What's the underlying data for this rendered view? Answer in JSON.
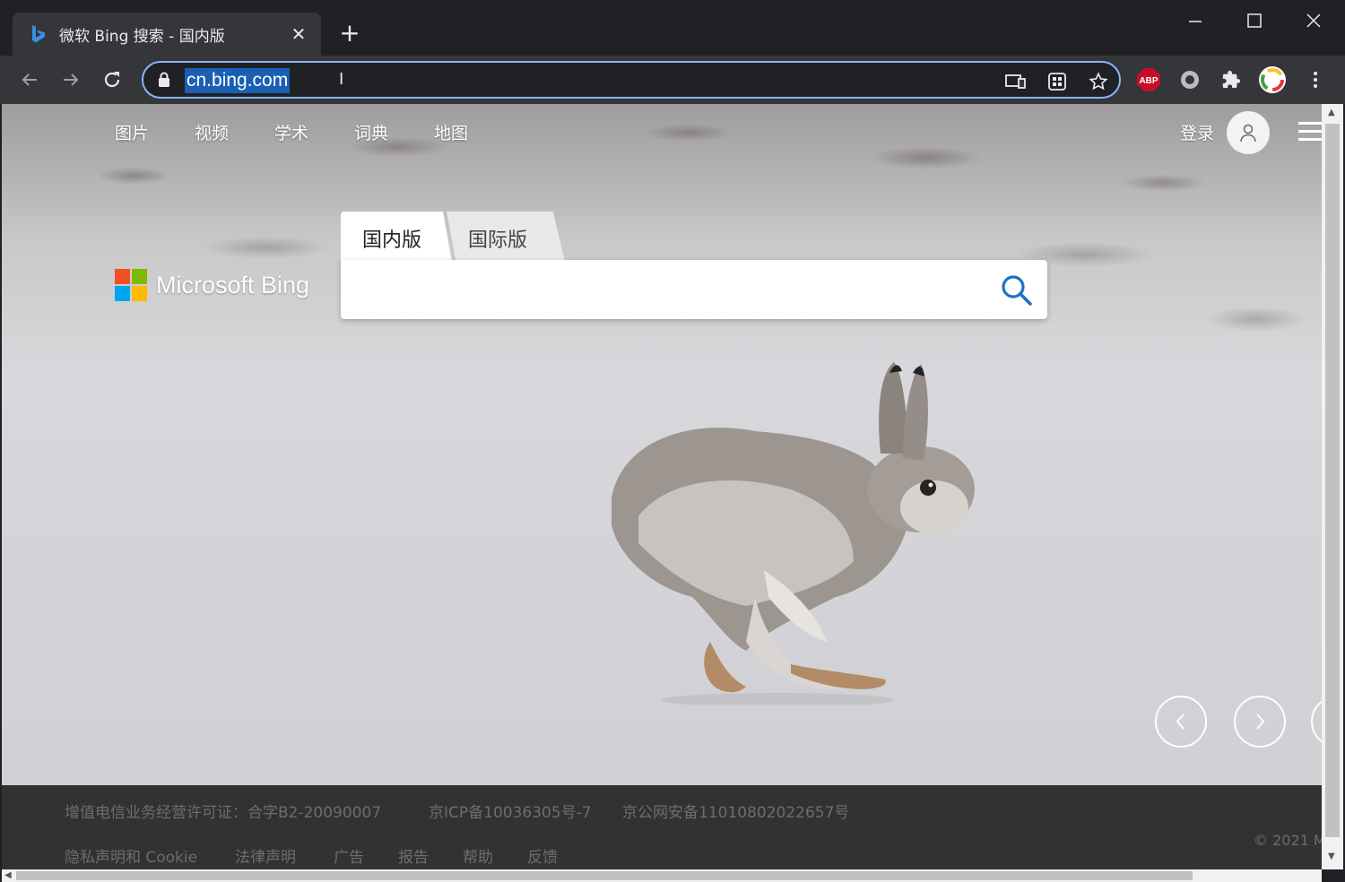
{
  "browser": {
    "tab_title": "微软 Bing 搜索 - 国内版",
    "tab_close_symbol": "✕",
    "new_tab_symbol": "+",
    "url": "cn.bing.com",
    "window_controls": {
      "minimize": "—",
      "maximize": "☐",
      "close": "✕"
    },
    "extensions": {
      "abp_label": "ABP"
    }
  },
  "page": {
    "nav": [
      "图片",
      "视频",
      "学术",
      "词典",
      "地图"
    ],
    "signin_label": "登录",
    "logo_text": "Microsoft Bing",
    "logo_colors": [
      "#f25022",
      "#7fba00",
      "#00a4ef",
      "#ffb900"
    ],
    "search": {
      "tabs": [
        "国内版",
        "国际版"
      ],
      "active_tab": "国内版",
      "query": "",
      "icon_color": "#1a73c8"
    },
    "carousel": {
      "prev_symbol": "‹",
      "next_symbol": "›"
    },
    "footer": {
      "row1": [
        "增值电信业务经营许可证：合字B2-20090007",
        "京ICP备10036305号-7",
        "京公网安备11010802022657号"
      ],
      "row2": [
        "隐私声明和 Cookie",
        "法律声明",
        "广告",
        "报告",
        "帮助",
        "反馈"
      ],
      "copyright": "© 2021 M"
    }
  },
  "colors": {
    "chrome_dark": "#202124",
    "chrome_toolbar": "#35363a",
    "url_highlight": "#1a5fb4",
    "abp_red": "#c70d2c"
  }
}
